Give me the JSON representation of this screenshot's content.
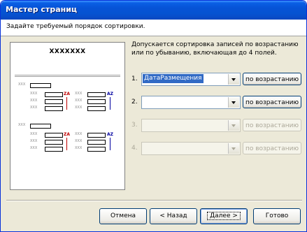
{
  "window": {
    "title": "Мастер страниц"
  },
  "header": {
    "text": "Задайте требуемый порядок сортировки."
  },
  "description": "Допускается сортировка записей по возрастанию или по убыванию, включающая до 4 полей.",
  "preview": {
    "title": "XXXXXXX",
    "placeholder": "XXX",
    "sort_desc_label": "ZA",
    "sort_asc_label": "AZ",
    "sort_desc_label_top": "ZA",
    "sort_asc_label_top": "AZ"
  },
  "sort_rows": [
    {
      "number": "1.",
      "field": "ДатаРазмещения",
      "order": "по возрастанию",
      "enabled": true
    },
    {
      "number": "2.",
      "field": "",
      "order": "по возрастанию",
      "enabled": true
    },
    {
      "number": "3.",
      "field": "",
      "order": "по возрастанию",
      "enabled": false
    },
    {
      "number": "4.",
      "field": "",
      "order": "по возрастанию",
      "enabled": false
    }
  ],
  "buttons": {
    "cancel": "Отмена",
    "back": "< Назад",
    "next": "Далее >",
    "finish": "Готово"
  },
  "colors": {
    "title_bar": "#0553d1",
    "window_bg": "#ece9d8",
    "selection": "#316ac5",
    "desc_arrow": "#c00000",
    "asc_arrow": "#0000a0"
  }
}
